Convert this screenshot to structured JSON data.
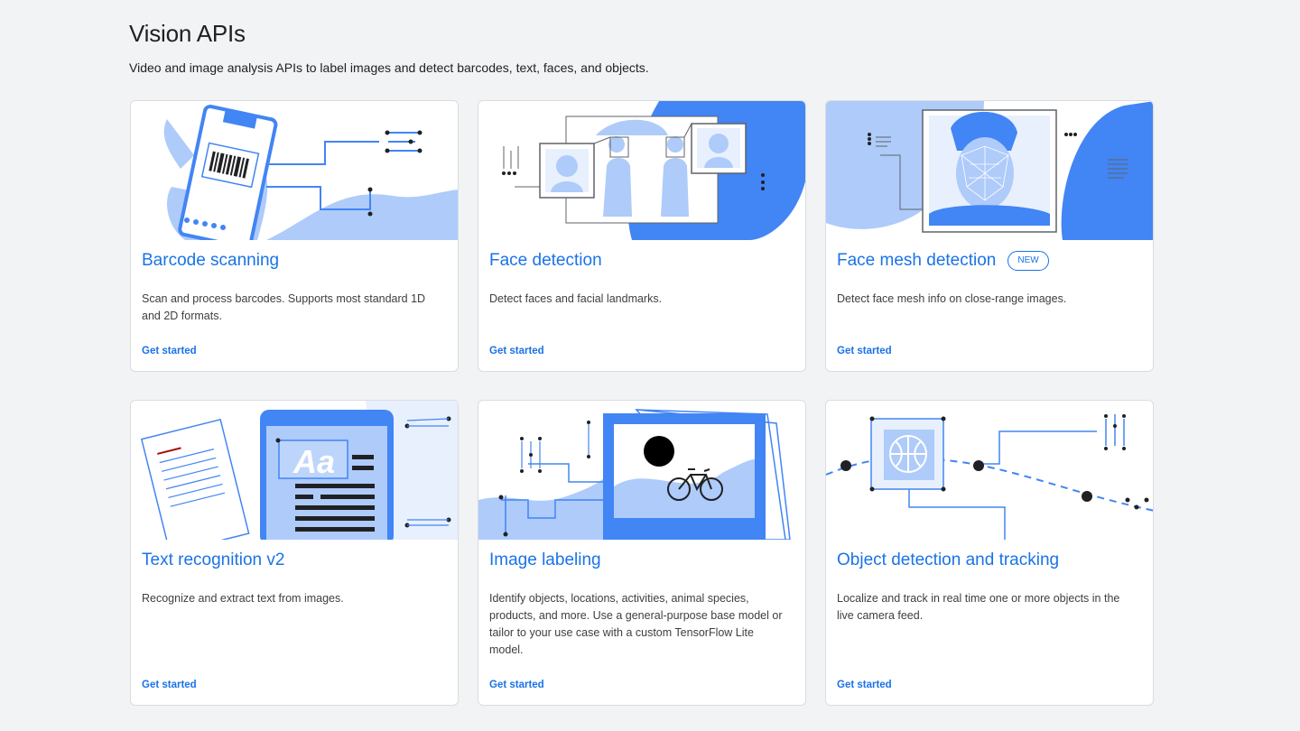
{
  "section": {
    "title": "Vision APIs",
    "description": "Video and image analysis APIs to label images and detect barcodes, text, faces, and objects."
  },
  "cards": [
    {
      "title": "Barcode scanning",
      "description": "Scan and process barcodes. Supports most standard 1D and 2D formats.",
      "link": "Get started",
      "icon": "barcode-scanning-illustration"
    },
    {
      "title": "Face detection",
      "description": "Detect faces and facial landmarks.",
      "link": "Get started",
      "icon": "face-detection-illustration"
    },
    {
      "title": "Face mesh detection",
      "badge": "NEW",
      "description": "Detect face mesh info on close-range images.",
      "link": "Get started",
      "icon": "face-mesh-illustration"
    },
    {
      "title": "Text recognition v2",
      "description": "Recognize and extract text from images.",
      "link": "Get started",
      "icon": "text-recognition-illustration"
    },
    {
      "title": "Image labeling",
      "description": "Identify objects, locations, activities, animal species, products, and more. Use a general-purpose base model or tailor to your use case with a custom TensorFlow Lite model.",
      "link": "Get started",
      "icon": "image-labeling-illustration"
    },
    {
      "title": "Object detection and tracking",
      "description": "Localize and track in real time one or more objects in the live camera feed.",
      "link": "Get started",
      "icon": "object-detection-illustration"
    }
  ],
  "colors": {
    "accent": "#1a73e8",
    "illustration_blue": "#4285f4",
    "illustration_light": "#aecbfa",
    "background": "#f1f3f4"
  }
}
